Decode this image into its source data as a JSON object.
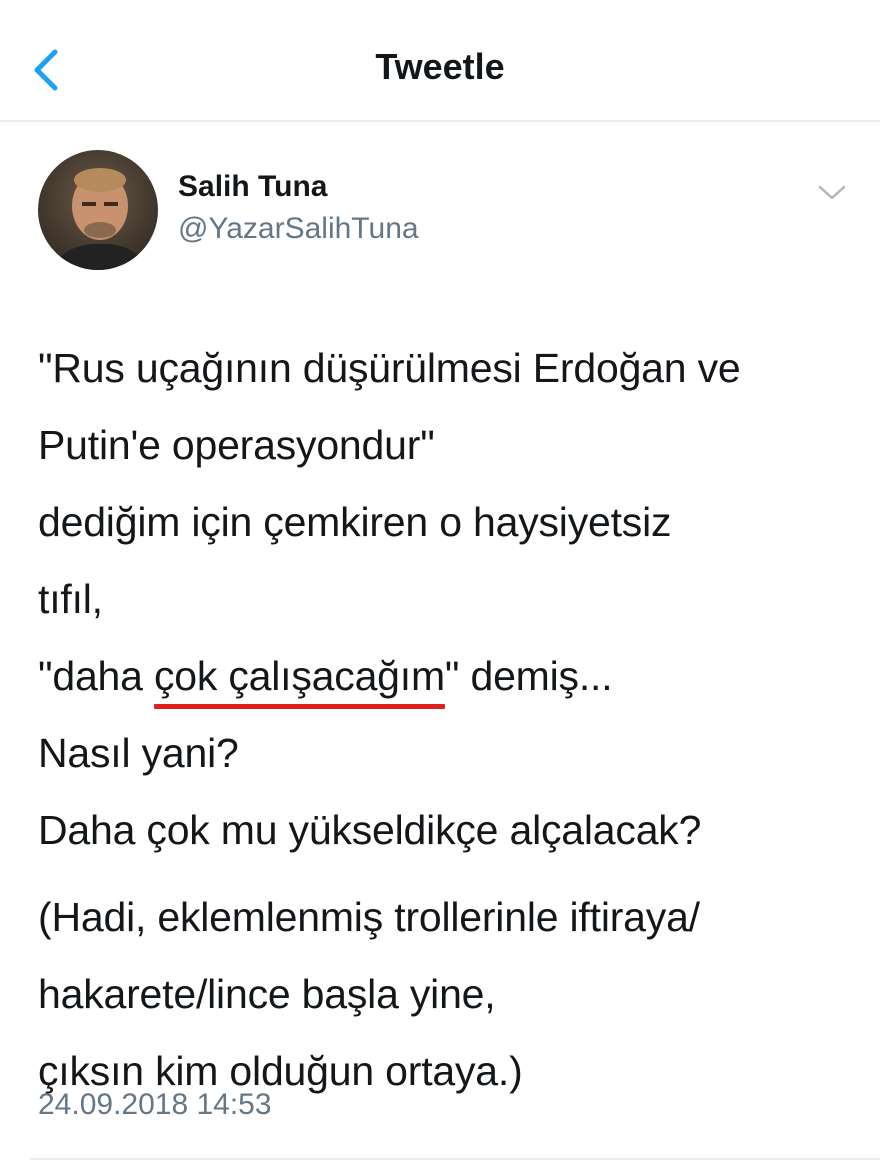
{
  "header": {
    "title": "Tweetle",
    "back_icon": "chevron-left-icon",
    "accent_color": "#1da1f2"
  },
  "author": {
    "name": "Salih Tuna",
    "handle": "@YazarSalihTuna",
    "more_icon": "chevron-down-icon"
  },
  "tweet": {
    "lines": [
      "\"Rus uçağının düşürülmesi Erdoğan ve",
      "Putin'e operasyondur\"",
      "dediğim için çemkiren o haysiyetsiz",
      "tıfıl,"
    ],
    "quote_prefix": "\"daha ",
    "quote_highlight": "çok çalışacağım",
    "quote_suffix": "\" demiş...",
    "lines_after": [
      "Nasıl yani?",
      "Daha çok mu yükseldikçe alçalacak?"
    ],
    "closing_lines": [
      "(Hadi, eklemlenmiş trollerinle iftiraya/",
      "hakarete/lince başla yine,",
      "çıksın kim olduğun ortaya.)"
    ],
    "underline_color": "#e01e1e"
  },
  "timestamp": "24.09.2018 14:53"
}
